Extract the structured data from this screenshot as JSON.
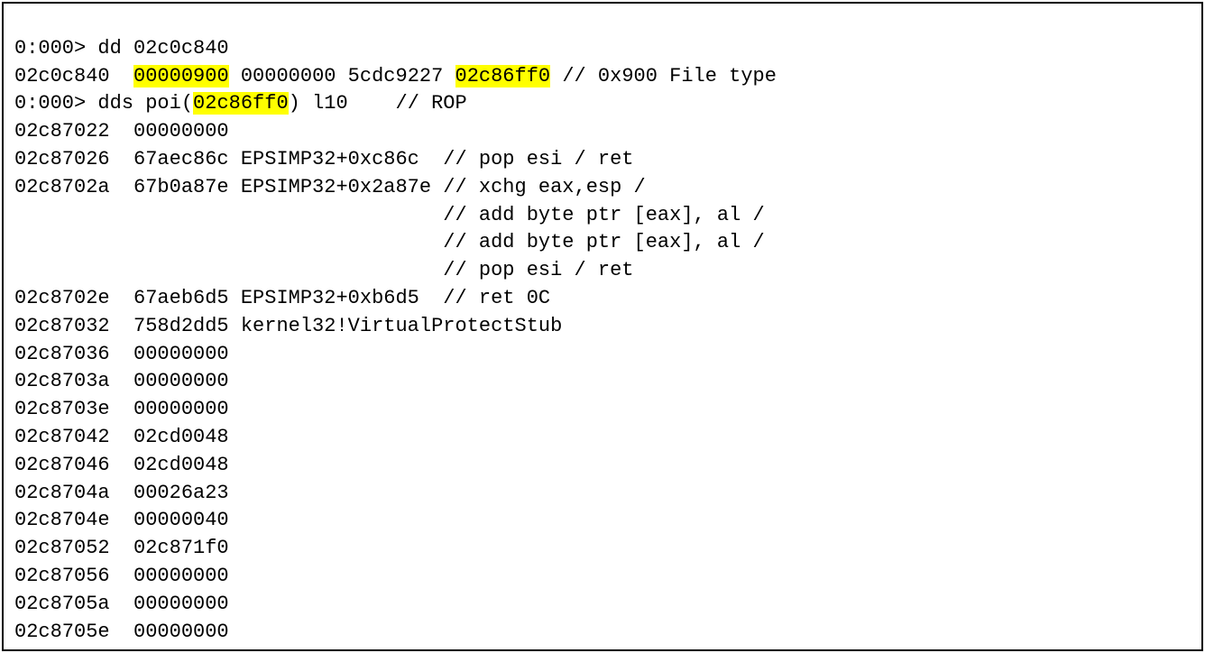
{
  "debugger_output": {
    "lines": [
      {
        "segments": [
          {
            "text": "0:000> dd 02c0c840",
            "hl": false
          }
        ]
      },
      {
        "segments": [
          {
            "text": "02c0c840  ",
            "hl": false
          },
          {
            "text": "00000900",
            "hl": true
          },
          {
            "text": " 00000000 5cdc9227 ",
            "hl": false
          },
          {
            "text": "02c86ff0",
            "hl": true
          },
          {
            "text": " // 0x900 File type",
            "hl": false
          }
        ]
      },
      {
        "segments": [
          {
            "text": "0:000> dds poi(",
            "hl": false
          },
          {
            "text": "02c86ff0",
            "hl": true
          },
          {
            "text": ") l10    // ROP",
            "hl": false
          }
        ]
      },
      {
        "segments": [
          {
            "text": "02c87022  00000000",
            "hl": false
          }
        ]
      },
      {
        "segments": [
          {
            "text": "02c87026  67aec86c EPSIMP32+0xc86c  // pop esi / ret",
            "hl": false
          }
        ]
      },
      {
        "segments": [
          {
            "text": "02c8702a  67b0a87e EPSIMP32+0x2a87e // xchg eax,esp /",
            "hl": false
          }
        ]
      },
      {
        "segments": [
          {
            "text": "                                    // add byte ptr [eax], al /",
            "hl": false
          }
        ]
      },
      {
        "segments": [
          {
            "text": "                                    // add byte ptr [eax], al /",
            "hl": false
          }
        ]
      },
      {
        "segments": [
          {
            "text": "                                    // pop esi / ret",
            "hl": false
          }
        ]
      },
      {
        "segments": [
          {
            "text": "02c8702e  67aeb6d5 EPSIMP32+0xb6d5  // ret 0C",
            "hl": false
          }
        ]
      },
      {
        "segments": [
          {
            "text": "02c87032  758d2dd5 kernel32!VirtualProtectStub",
            "hl": false
          }
        ]
      },
      {
        "segments": [
          {
            "text": "02c87036  00000000",
            "hl": false
          }
        ]
      },
      {
        "segments": [
          {
            "text": "02c8703a  00000000",
            "hl": false
          }
        ]
      },
      {
        "segments": [
          {
            "text": "02c8703e  00000000",
            "hl": false
          }
        ]
      },
      {
        "segments": [
          {
            "text": "02c87042  02cd0048",
            "hl": false
          }
        ]
      },
      {
        "segments": [
          {
            "text": "02c87046  02cd0048",
            "hl": false
          }
        ]
      },
      {
        "segments": [
          {
            "text": "02c8704a  00026a23",
            "hl": false
          }
        ]
      },
      {
        "segments": [
          {
            "text": "02c8704e  00000040",
            "hl": false
          }
        ]
      },
      {
        "segments": [
          {
            "text": "02c87052  02c871f0",
            "hl": false
          }
        ]
      },
      {
        "segments": [
          {
            "text": "02c87056  00000000",
            "hl": false
          }
        ]
      },
      {
        "segments": [
          {
            "text": "02c8705a  00000000",
            "hl": false
          }
        ]
      },
      {
        "segments": [
          {
            "text": "02c8705e  00000000",
            "hl": false
          }
        ]
      }
    ]
  }
}
